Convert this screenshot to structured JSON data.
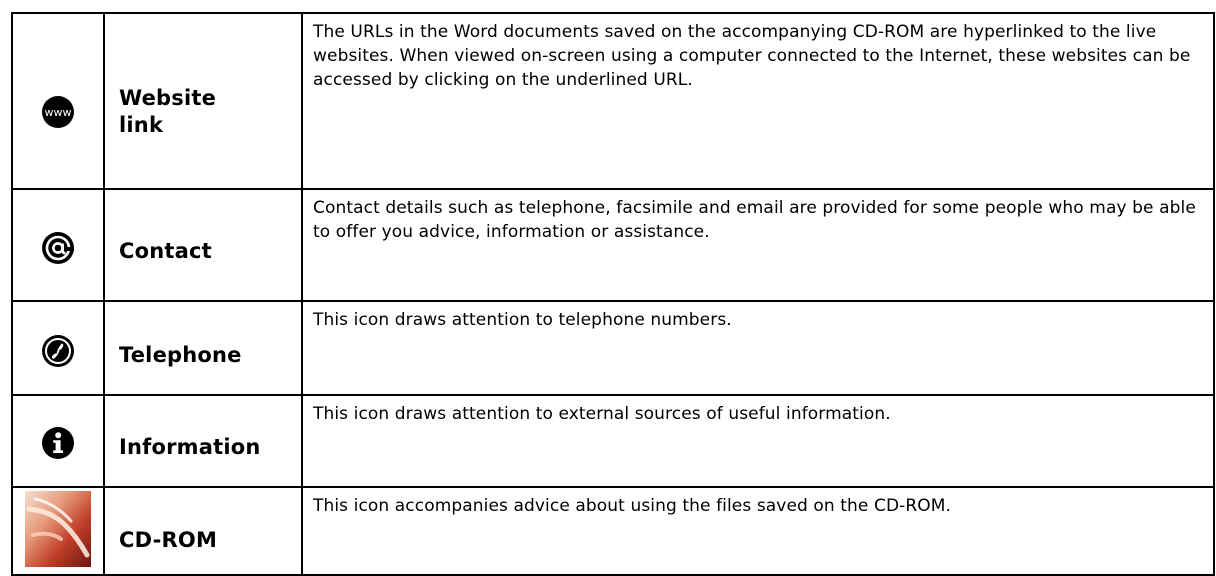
{
  "rows": [
    {
      "icon": "www-icon",
      "name": "Website\nlink",
      "name_line1": "Website",
      "name_line2": "link",
      "description": "The URLs in the Word documents saved on  the accompanying CD-ROM are hyperlinked to the live websites.  When viewed on-screen using a computer connected to the Internet, these websites can be accessed by clicking on the underlined URL."
    },
    {
      "icon": "at-sign-icon",
      "name": "Contact",
      "description": "Contact details such as telephone, facsimile and email are provided for some people who may be able to offer you advice, information or assistance."
    },
    {
      "icon": "telephone-icon",
      "name": "Telephone",
      "description": "This icon draws attention to telephone numbers."
    },
    {
      "icon": "information-icon",
      "name": "Information",
      "description": "This icon draws attention to external sources of useful information."
    },
    {
      "icon": "cd-rom-icon",
      "name": "CD-ROM",
      "description": "This icon accompanies advice about using the files saved on the CD-ROM."
    }
  ],
  "colors": {
    "border": "#000000",
    "icon_fill": "#000000",
    "cdrom_accent": "#c9462e"
  }
}
